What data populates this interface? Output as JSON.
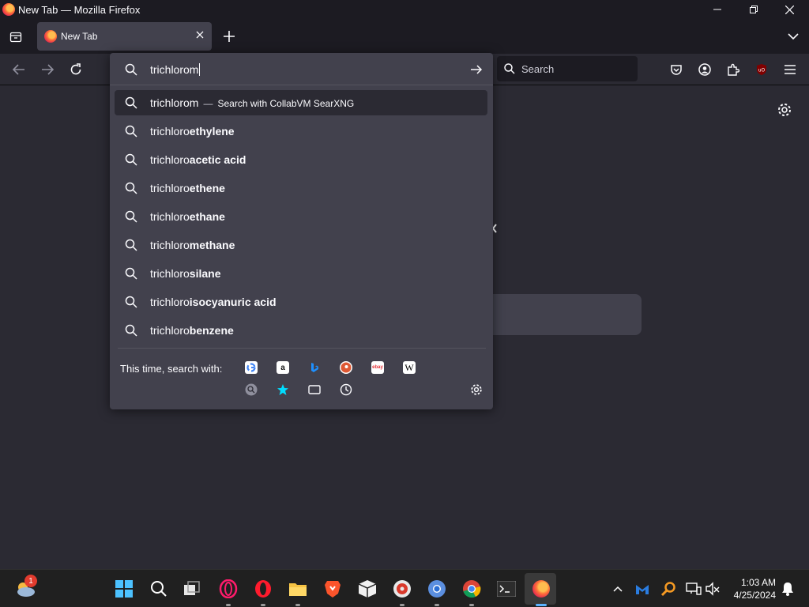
{
  "window": {
    "title": "New Tab — Mozilla Firefox"
  },
  "tab": {
    "label": "New Tab"
  },
  "toolbar": {
    "search_placeholder": "Search"
  },
  "urlbar": {
    "value": "trichlorom",
    "heuristic": {
      "text": "trichlorom",
      "separator": "—",
      "action": "Search with CollabVM SearXNG"
    },
    "suggestions": [
      {
        "prefix": "trichloro",
        "bold": "ethylene"
      },
      {
        "prefix": "trichloro",
        "bold": "acetic acid"
      },
      {
        "prefix": "trichloro",
        "bold": "ethene"
      },
      {
        "prefix": "trichloro",
        "bold": "ethane"
      },
      {
        "prefix": "trichloro",
        "bold": "methane"
      },
      {
        "prefix": "trichloro",
        "bold": "silane"
      },
      {
        "prefix": "trichloro",
        "bold": "isocyanuric acid"
      },
      {
        "prefix": "trichloro",
        "bold": "benzene"
      }
    ],
    "one_off_label": "This time, search with:",
    "engines": [
      "google-icon",
      "amazon-icon",
      "bing-icon",
      "duckduckgo-icon",
      "ebay-icon",
      "wikipedia-icon",
      "searxng-icon",
      "bookmarks-icon",
      "tabs-icon",
      "history-icon"
    ],
    "engine_glyphs": {
      "amazon": "a",
      "ebay": "ebay",
      "wikipedia": "W"
    }
  },
  "taskbar": {
    "weather_badge": "1",
    "time": "1:03 AM",
    "date": "4/25/2024"
  },
  "colors": {
    "toolbar": "#2b2a33",
    "popup": "#42414d",
    "accent": "#5cb3ff"
  }
}
